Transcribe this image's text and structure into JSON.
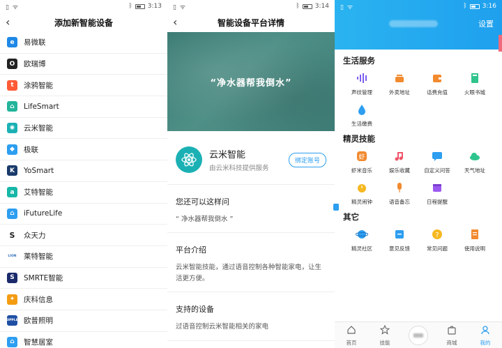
{
  "panel1": {
    "status_time": "3:13",
    "title": "添加新智能设备",
    "items": [
      {
        "label": "易微联",
        "logo_text": "e",
        "color": "#1e88e5"
      },
      {
        "label": "欧瑞博",
        "logo_text": "O",
        "color": "#222222"
      },
      {
        "label": "涂鸦智能",
        "logo_text": "t",
        "color": "#ff5a36"
      },
      {
        "label": "LifeSmart",
        "logo_text": "⌂",
        "color": "#23b49b"
      },
      {
        "label": "云米智能",
        "logo_text": "✺",
        "color": "#1bb1b4"
      },
      {
        "label": "极联",
        "logo_text": "◆",
        "color": "#2d9ef0"
      },
      {
        "label": "YoSmart",
        "logo_text": "K",
        "color": "#1a3a6b"
      },
      {
        "label": "艾特智能",
        "logo_text": "a",
        "color": "#16b7a8"
      },
      {
        "label": "iFutureLife",
        "logo_text": "⌂",
        "color": "#2d9ef0"
      },
      {
        "label": "众天力",
        "logo_text": "S",
        "color": "#d9c6a5"
      },
      {
        "label": "莱特智能",
        "logo_text": "LION",
        "color": "#ffffff"
      },
      {
        "label": "SMRTE智能",
        "logo_text": "S",
        "color": "#1a2a6b"
      },
      {
        "label": "庆科信息",
        "logo_text": "✦",
        "color": "#f39c12"
      },
      {
        "label": "欧普照明",
        "logo_text": "OPPLE",
        "color": "#1e4fa3"
      },
      {
        "label": "智慧居室",
        "logo_text": "⌂",
        "color": "#2d9ef0"
      }
    ]
  },
  "panel2": {
    "status_time": "3:14",
    "title": "智能设备平台详情",
    "hero_quote": "“净水器帮我倒水”",
    "provider_name": "云米智能",
    "provider_sub": "由云米科技提供服务",
    "bind_label": "绑定账号",
    "sections": [
      {
        "title": "您还可以这样问",
        "body": "“ 净水器帮我倒水 ”"
      },
      {
        "title": "平台介绍",
        "body": "云米智能技能，通过语音控制各种智能家电，让生活更方便。"
      },
      {
        "title": "支持的设备",
        "body": "过语音控制云米智能相关的家电"
      }
    ]
  },
  "panel3": {
    "status_time": "3:16",
    "settings_label": "设置",
    "groups": [
      {
        "title": "生活服务",
        "items": [
          {
            "label": "声纹管理",
            "icon": "soundwave-icon",
            "color": "#7b5cf0"
          },
          {
            "label": "外卖地址",
            "icon": "pot-icon",
            "color": "#f28a2e"
          },
          {
            "label": "话费充值",
            "icon": "wallet-icon",
            "color": "#f28a2e"
          },
          {
            "label": "火眼书城",
            "icon": "book-icon",
            "color": "#2fc48d"
          },
          {
            "label": "生活缴费",
            "icon": "drop-icon",
            "color": "#2d9ef0"
          }
        ]
      },
      {
        "title": "精灵技能",
        "items": [
          {
            "label": "虾米音乐",
            "icon": "xiami-icon",
            "color": "#f28a2e"
          },
          {
            "label": "娱乐收藏",
            "icon": "music-icon",
            "color": "#f0566a"
          },
          {
            "label": "自定义问答",
            "icon": "chat-icon",
            "color": "#2d9ef0"
          },
          {
            "label": "天气地址",
            "icon": "cloud-icon",
            "color": "#2fc48d"
          },
          {
            "label": "精灵闹钟",
            "icon": "clock-icon",
            "color": "#f5b81f"
          },
          {
            "label": "语音备忘",
            "icon": "mic-icon",
            "color": "#f28a2e"
          },
          {
            "label": "日程提醒",
            "icon": "calendar-icon",
            "color": "#9b59f0"
          }
        ]
      },
      {
        "title": "其它",
        "items": [
          {
            "label": "精灵社区",
            "icon": "planet-icon",
            "color": "#2d9ef0"
          },
          {
            "label": "意见反馈",
            "icon": "feedback-icon",
            "color": "#2d9ef0"
          },
          {
            "label": "常见问题",
            "icon": "question-icon",
            "color": "#f5b81f"
          },
          {
            "label": "使用说明",
            "icon": "manual-icon",
            "color": "#f28a2e"
          }
        ]
      }
    ],
    "tabs": [
      {
        "label": "首页",
        "icon": "home-icon"
      },
      {
        "label": "技能",
        "icon": "star-icon"
      },
      {
        "label": "",
        "icon": "center-icon"
      },
      {
        "label": "商城",
        "icon": "shop-icon"
      },
      {
        "label": "我的",
        "icon": "profile-icon"
      }
    ]
  }
}
